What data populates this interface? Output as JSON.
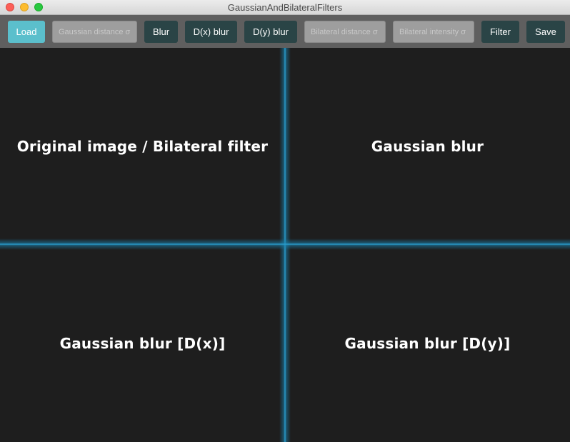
{
  "window": {
    "title": "GaussianAndBilateralFilters"
  },
  "toolbar": {
    "load_label": "Load",
    "gaussian_distance_placeholder": "Gaussian distance σ",
    "blur_label": "Blur",
    "dx_blur_label": "D(x) blur",
    "dy_blur_label": "D(y) blur",
    "bilateral_distance_placeholder": "Bilateral distance σ",
    "bilateral_intensity_placeholder": "Bilateral intensity σ",
    "filter_label": "Filter",
    "save_label": "Save"
  },
  "panes": {
    "top_left": "Original image / Bilateral filter",
    "top_right": "Gaussian blur",
    "bottom_left": "Gaussian blur [D(x)]",
    "bottom_right": "Gaussian blur [D(y)]"
  },
  "colors": {
    "accent": "#5bbfcc",
    "button": "#2a4446",
    "divider_glow": "#2a9fd0",
    "background": "#1e1e1e"
  },
  "icons": {
    "close": "close-icon",
    "minimize": "minimize-icon",
    "maximize": "maximize-icon"
  }
}
